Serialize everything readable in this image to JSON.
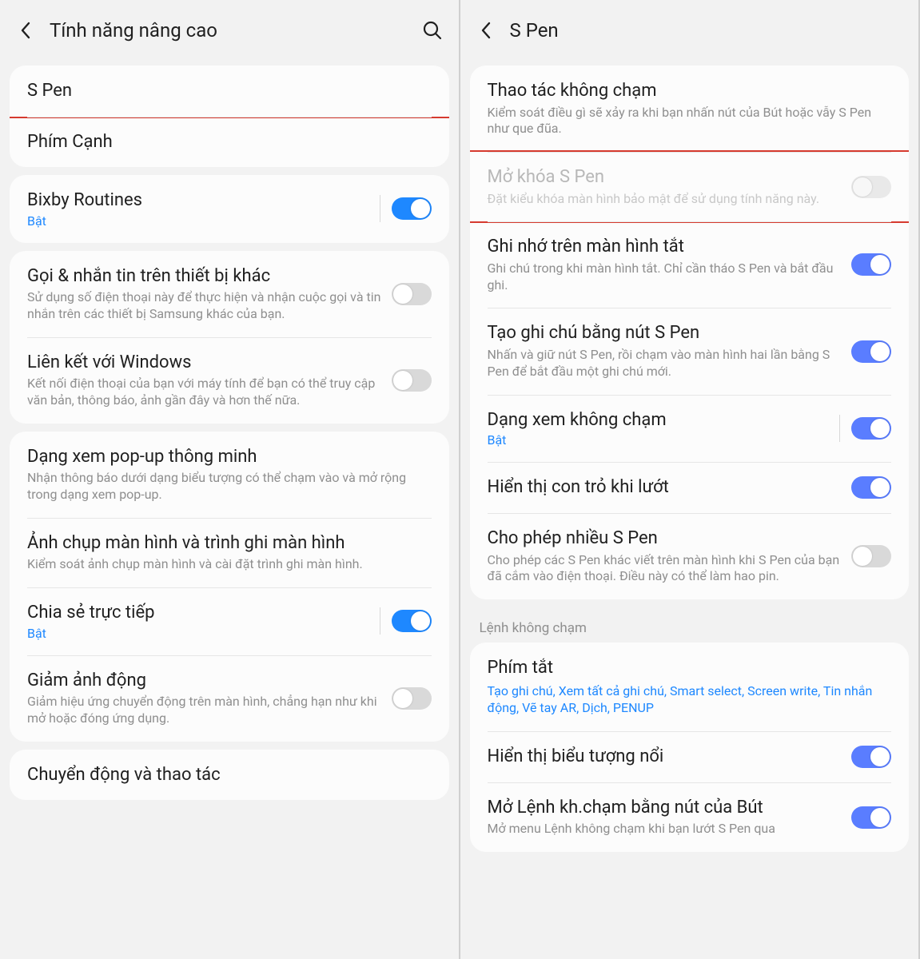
{
  "left": {
    "header": {
      "title": "Tính năng nâng cao"
    },
    "group1": {
      "spen": {
        "title": "S Pen"
      },
      "edge": {
        "title": "Phím Cạnh"
      }
    },
    "group2": {
      "bixby": {
        "title": "Bixby Routines",
        "status": "Bật"
      }
    },
    "group3": {
      "call": {
        "title": "Gọi & nhắn tin trên thiết bị khác",
        "sub": "Sử dụng số điện thoại này để thực hiện và nhận cuộc gọi và tin nhắn trên các thiết bị Samsung khác của bạn."
      },
      "win": {
        "title": "Liên kết với Windows",
        "sub": "Kết nối điện thoại của bạn với máy tính để bạn có thể truy cập văn bản, thông báo, ảnh gần đây và hơn thế nữa."
      }
    },
    "group4": {
      "popup": {
        "title": "Dạng xem pop-up thông minh",
        "sub": "Nhận thông báo dưới dạng biểu tượng có thể chạm vào và mở rộng trong dạng xem pop-up."
      },
      "shot": {
        "title": "Ảnh chụp màn hình và trình ghi màn hình",
        "sub": "Kiểm soát ảnh chụp màn hình và cài đặt trình ghi màn hình."
      },
      "share": {
        "title": "Chia sẻ trực tiếp",
        "status": "Bật"
      },
      "motion": {
        "title": "Giảm ảnh động",
        "sub": "Giảm hiệu ứng chuyển động trên màn hình, chẳng hạn như khi mở hoặc đóng ứng dụng."
      }
    },
    "group5": {
      "gesture": {
        "title": "Chuyển động và thao tác"
      }
    }
  },
  "right": {
    "header": {
      "title": "S Pen"
    },
    "card1": {
      "air": {
        "title": "Thao tác không chạm",
        "sub": "Kiểm soát điều gì sẽ xảy ra khi bạn nhấn nút của Bút hoặc vẫy S Pen như que đũa."
      },
      "unlock": {
        "title": "Mở khóa S Pen",
        "sub": "Đặt kiểu khóa màn hình bảo mật để sử dụng tính năng này."
      },
      "memo": {
        "title": "Ghi nhớ trên màn hình tắt",
        "sub": "Ghi chú trong khi màn hình tắt. Chỉ cần tháo S Pen và bắt đầu ghi."
      },
      "note": {
        "title": "Tạo ghi chú bằng nút S Pen",
        "sub": "Nhấn và giữ nút S Pen, rồi chạm vào màn hình hai lần bằng S Pen để bắt đầu một ghi chú mới."
      },
      "airview": {
        "title": "Dạng xem không chạm",
        "status": "Bật"
      },
      "pointer": {
        "title": "Hiển thị con trỏ khi lướt"
      },
      "multi": {
        "title": "Cho phép nhiều S Pen",
        "sub": "Cho phép các S Pen khác viết trên màn hình khi S Pen của bạn đã cắm vào điện thoại. Điều này có thể làm hao pin."
      }
    },
    "sectionLabel": "Lệnh không chạm",
    "card2": {
      "shortcut": {
        "title": "Phím tắt",
        "blue": "Tạo ghi chú, Xem tất cả ghi chú, Smart select, Screen write, Tin nhắn động, Vẽ tay AR, Dịch, PENUP"
      },
      "float": {
        "title": "Hiển thị biểu tượng nổi"
      },
      "openCmd": {
        "title": "Mở Lệnh kh.chạm bằng nút của Bút",
        "sub": "Mở menu Lệnh không chạm khi bạn lướt S Pen qua"
      }
    }
  }
}
